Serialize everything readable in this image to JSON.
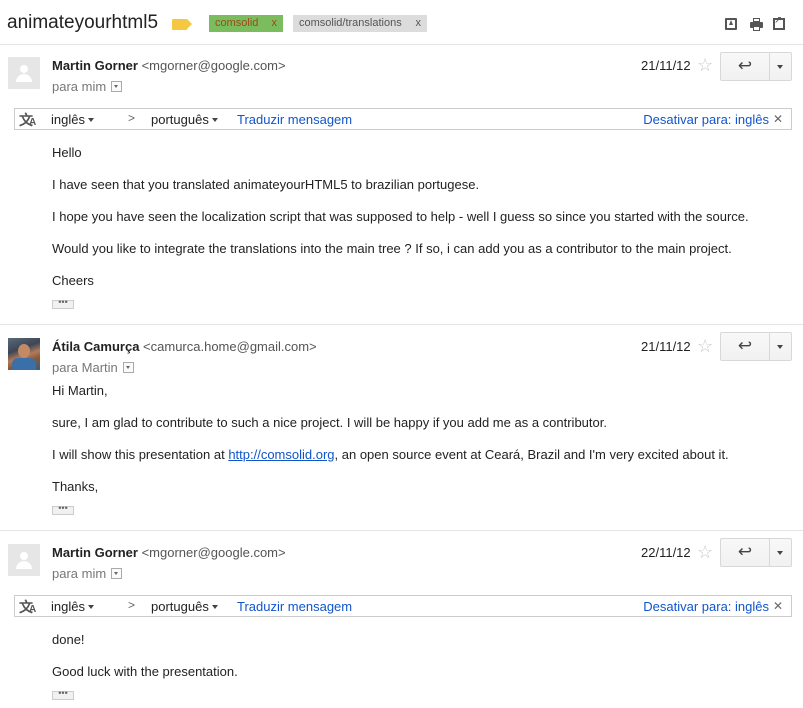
{
  "header": {
    "subject": "animateyourhtml5",
    "labels": [
      {
        "text": "comsolid",
        "remove": "x",
        "color": "#7bbd5e"
      },
      {
        "text": "comsolid/translations",
        "remove": "x",
        "color": "#dcdcdc"
      }
    ]
  },
  "translate_bar": {
    "from": "inglês",
    "to": "português",
    "translate": "Traduzir mensagem",
    "disable": "Desativar para: inglês",
    "close": "✕"
  },
  "messages": [
    {
      "sender_name": "Martin Gorner",
      "sender_email": "<mgorner@google.com>",
      "to": "para mim",
      "date": "21/11/12",
      "body": [
        "Hello",
        "I have seen that you translated animateyourHTML5 to brazilian portugese.",
        "I hope you have seen the localization script that was supposed to help - well I guess so since you started with the source.",
        "Would you like to integrate the translations into the main tree ? If so, i can add you as a contributor to the main project.",
        "Cheers"
      ]
    },
    {
      "sender_name": "Átila Camurça",
      "sender_email": "<camurca.home@gmail.com>",
      "to": "para Martin",
      "date": "21/11/12",
      "body": [
        "Hi Martin,",
        "sure, I am glad to contribute to such a nice project. I will be happy if you add me as a contributor.",
        "I will show this presentation at ",
        "Thanks,"
      ],
      "link": "http://comsolid.org",
      "link_after": ", an open source event at Ceará, Brazil and I'm very excited about it."
    },
    {
      "sender_name": "Martin Gorner",
      "sender_email": "<mgorner@google.com>",
      "to": "para mim",
      "date": "22/11/12",
      "body": [
        "done!",
        "Good luck with the presentation."
      ]
    }
  ],
  "icons": {
    "star": "☆",
    "reply": "↩",
    "ellipsis": "•••"
  }
}
